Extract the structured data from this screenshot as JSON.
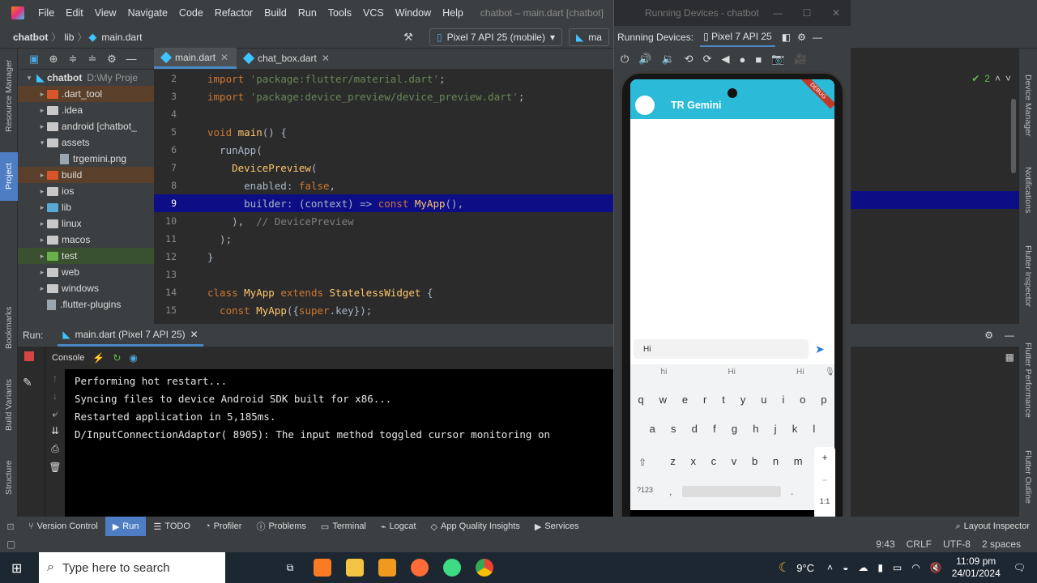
{
  "menubar": {
    "items": [
      "File",
      "Edit",
      "View",
      "Navigate",
      "Code",
      "Refactor",
      "Build",
      "Run",
      "Tools",
      "VCS",
      "Window",
      "Help"
    ],
    "window_title": "chatbot – main.dart [chatbot]"
  },
  "navbar": {
    "crumbs": [
      "chatbot",
      "lib",
      "main.dart"
    ],
    "device_selector": "Pixel 7 API 25 (mobile)",
    "second_selector": "ma"
  },
  "left_strip": {
    "resource_manager": "Resource Manager",
    "project": "Project",
    "bookmarks": "Bookmarks",
    "build_variants": "Build Variants",
    "structure": "Structure"
  },
  "project_tree": [
    {
      "label": "chatbot",
      "extra": "D:\\My Proje",
      "kind": "root",
      "indent": 0,
      "expanded": true
    },
    {
      "label": ".dart_tool",
      "kind": "folder-orange",
      "indent": 1,
      "highlight": "orange"
    },
    {
      "label": ".idea",
      "kind": "folder",
      "indent": 1
    },
    {
      "label": "android [chatbot_",
      "kind": "folder",
      "indent": 1
    },
    {
      "label": "assets",
      "kind": "folder",
      "indent": 1,
      "expanded": true
    },
    {
      "label": "trgemini.png",
      "kind": "file",
      "indent": 2
    },
    {
      "label": "build",
      "kind": "folder-orange",
      "indent": 1,
      "highlight": "orange"
    },
    {
      "label": "ios",
      "kind": "folder",
      "indent": 1
    },
    {
      "label": "lib",
      "kind": "folder-blue",
      "indent": 1
    },
    {
      "label": "linux",
      "kind": "folder",
      "indent": 1
    },
    {
      "label": "macos",
      "kind": "folder",
      "indent": 1
    },
    {
      "label": "test",
      "kind": "folder-green",
      "indent": 1,
      "highlight": "green"
    },
    {
      "label": "web",
      "kind": "folder",
      "indent": 1
    },
    {
      "label": "windows",
      "kind": "folder",
      "indent": 1
    },
    {
      "label": ".flutter-plugins",
      "kind": "file",
      "indent": 1
    }
  ],
  "editor": {
    "tabs": [
      "main.dart",
      "chat_box.dart"
    ],
    "lines": [
      {
        "n": "2",
        "parts": [
          [
            "kw",
            "import "
          ],
          [
            "str",
            "'package:flutter/material.dart'"
          ],
          [
            "txt",
            ";"
          ]
        ]
      },
      {
        "n": "3",
        "parts": [
          [
            "kw",
            "import "
          ],
          [
            "str",
            "'package:device_preview/device_preview.dart'"
          ],
          [
            "txt",
            ";"
          ]
        ]
      },
      {
        "n": "4",
        "parts": []
      },
      {
        "n": "5",
        "parts": [
          [
            "kw",
            "void "
          ],
          [
            "cls",
            "main"
          ],
          [
            "txt",
            "() {"
          ]
        ]
      },
      {
        "n": "6",
        "parts": [
          [
            "txt",
            "  runApp("
          ]
        ]
      },
      {
        "n": "7",
        "parts": [
          [
            "cls",
            "    DevicePreview"
          ],
          [
            "txt",
            "("
          ]
        ]
      },
      {
        "n": "8",
        "parts": [
          [
            "txt",
            "      enabled: "
          ],
          [
            "lit",
            "false"
          ],
          [
            "txt",
            ","
          ]
        ]
      },
      {
        "n": "9",
        "parts": [
          [
            "txt",
            "      builder: (context) => "
          ],
          [
            "kw",
            "const "
          ],
          [
            "cls",
            "MyApp"
          ],
          [
            "txt",
            "(),"
          ]
        ],
        "highlight": true
      },
      {
        "n": "10",
        "parts": [
          [
            "txt",
            "    ),  "
          ],
          [
            "cmt",
            "// DevicePreview"
          ]
        ]
      },
      {
        "n": "11",
        "parts": [
          [
            "txt",
            "  );"
          ]
        ]
      },
      {
        "n": "12",
        "parts": [
          [
            "txt",
            "}"
          ]
        ]
      },
      {
        "n": "13",
        "parts": []
      },
      {
        "n": "14",
        "parts": [
          [
            "kw",
            "class "
          ],
          [
            "cls",
            "MyApp "
          ],
          [
            "kw",
            "extends "
          ],
          [
            "cls",
            "StatelessWidget "
          ],
          [
            "txt",
            "{"
          ]
        ]
      },
      {
        "n": "15",
        "parts": [
          [
            "kw",
            "  const "
          ],
          [
            "cls",
            "MyApp"
          ],
          [
            "txt",
            "({"
          ],
          [
            "kw",
            "super"
          ],
          [
            "txt",
            ".key});"
          ]
        ]
      }
    ]
  },
  "run": {
    "label": "Run:",
    "tab": "main.dart (Pixel 7 API 25)",
    "console_tab": "Console",
    "output": [
      "Performing hot restart...",
      "Syncing files to device Android SDK built for x86...",
      "Restarted application in 5,185ms.",
      "D/InputConnectionAdaptor( 8905): The input method toggled cursor monitoring on"
    ]
  },
  "running_devices": {
    "window_title": "Running Devices - chatbot",
    "label": "Running Devices:",
    "device_tab": "Pixel 7 API 25"
  },
  "phone": {
    "app_title": "TR Gemini",
    "input_text": "Hi",
    "suggestions": [
      "hi",
      "Hi",
      "Hi"
    ],
    "row1": [
      "q",
      "w",
      "e",
      "r",
      "t",
      "y",
      "u",
      "i",
      "o",
      "p"
    ],
    "row2": [
      "a",
      "s",
      "d",
      "f",
      "g",
      "h",
      "j",
      "k",
      "l"
    ],
    "row3": [
      "z",
      "x",
      "c",
      "v",
      "b",
      "n",
      "m"
    ],
    "symbols_key": "?123",
    "comma_key": ",",
    "period_key": ".",
    "debug_banner": "DEBUG",
    "zoom_plus": "+",
    "zoom_ratio": "1:1"
  },
  "right_strip": {
    "device_manager": "Device Manager",
    "notifications": "Notifications",
    "flutter_inspector": "Flutter Inspector",
    "flutter_performance": "Flutter Performance",
    "flutter_outline": "Flutter Outline"
  },
  "problems_count": "2",
  "bottom_tabs": [
    "Version Control",
    "Run",
    "TODO",
    "Profiler",
    "Problems",
    "Terminal",
    "Logcat",
    "App Quality Insights",
    "Services",
    "Layout Inspector"
  ],
  "status": {
    "position": "9:43",
    "line_sep": "CRLF",
    "encoding": "UTF-8",
    "indent": "2 spaces"
  },
  "taskbar": {
    "search_placeholder": "Type here to search",
    "weather": "9°C",
    "time": "11:09 pm",
    "date": "24/01/2024"
  }
}
